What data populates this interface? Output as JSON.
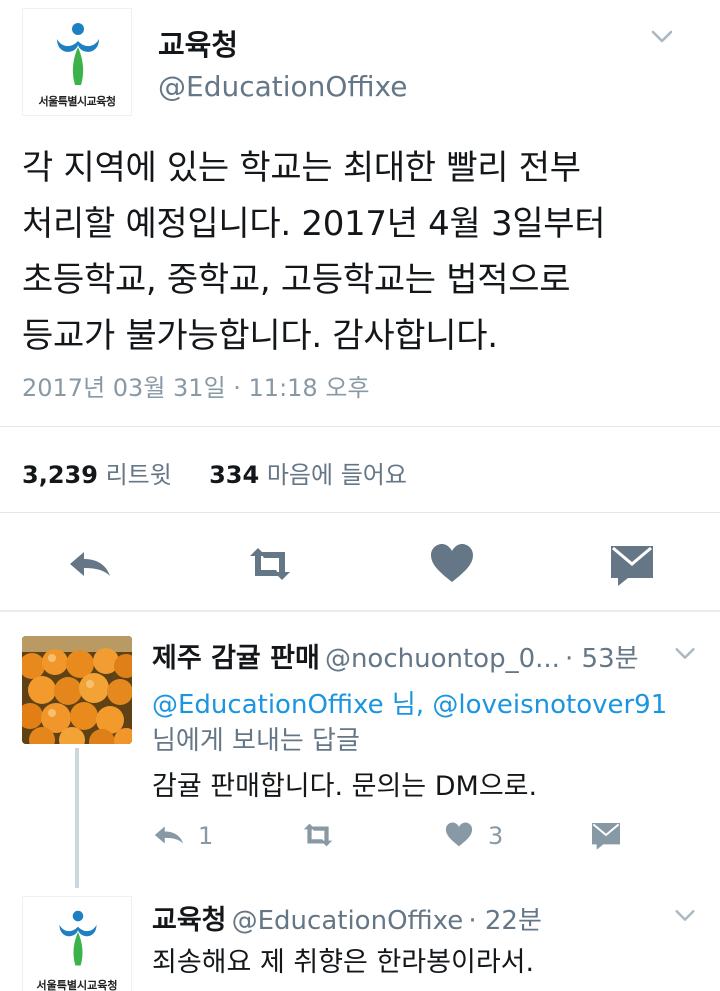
{
  "main_tweet": {
    "author_name": "교육청",
    "author_handle": "@EducationOffixe",
    "logo_text": "서울특별시교육청",
    "text_lines": [
      "각 지역에 있는 학교는 최대한 빨리 전부",
      "처리할 예정입니다. 2017년 4월 3일부터",
      "초등학교, 중학교, 고등학교는 법적으로",
      "등교가 불가능합니다. 감사합니다."
    ],
    "timestamp": "2017년 03월 31일 · 11:18 오후",
    "retweet_count": "3,239",
    "retweet_label": "리트윗",
    "like_count": "334",
    "like_label": "마음에 들어요"
  },
  "reply_1": {
    "author_name": "제주 감귤 판매",
    "author_handle": "@nochuontop_0...",
    "time_ago": "· 53분",
    "reply_to_mention_1": "@EducationOffixe 님,",
    "reply_to_mention_2": "@loveisnotover91",
    "reply_to_suffix": "님에게 보내는 답글",
    "text": "감귤 판매합니다. 문의는 DM으로.",
    "reply_count": "1",
    "like_count": "3"
  },
  "reply_2": {
    "author_name": "교육청",
    "author_handle": "@EducationOffixe",
    "time_ago": "· 22분",
    "logo_text": "서울특별시교육청",
    "text": "죄송해요 제 취향은 한라봉이라서."
  },
  "colors": {
    "primary_text": "#14171a",
    "secondary_text": "#657786",
    "link": "#1b95e0",
    "icon": "#657786",
    "logo_blue": "#1e7fc2",
    "logo_green": "#3bb34a"
  },
  "icons": [
    "chevron-down-icon",
    "reply-icon",
    "retweet-icon",
    "heart-icon",
    "message-icon"
  ]
}
